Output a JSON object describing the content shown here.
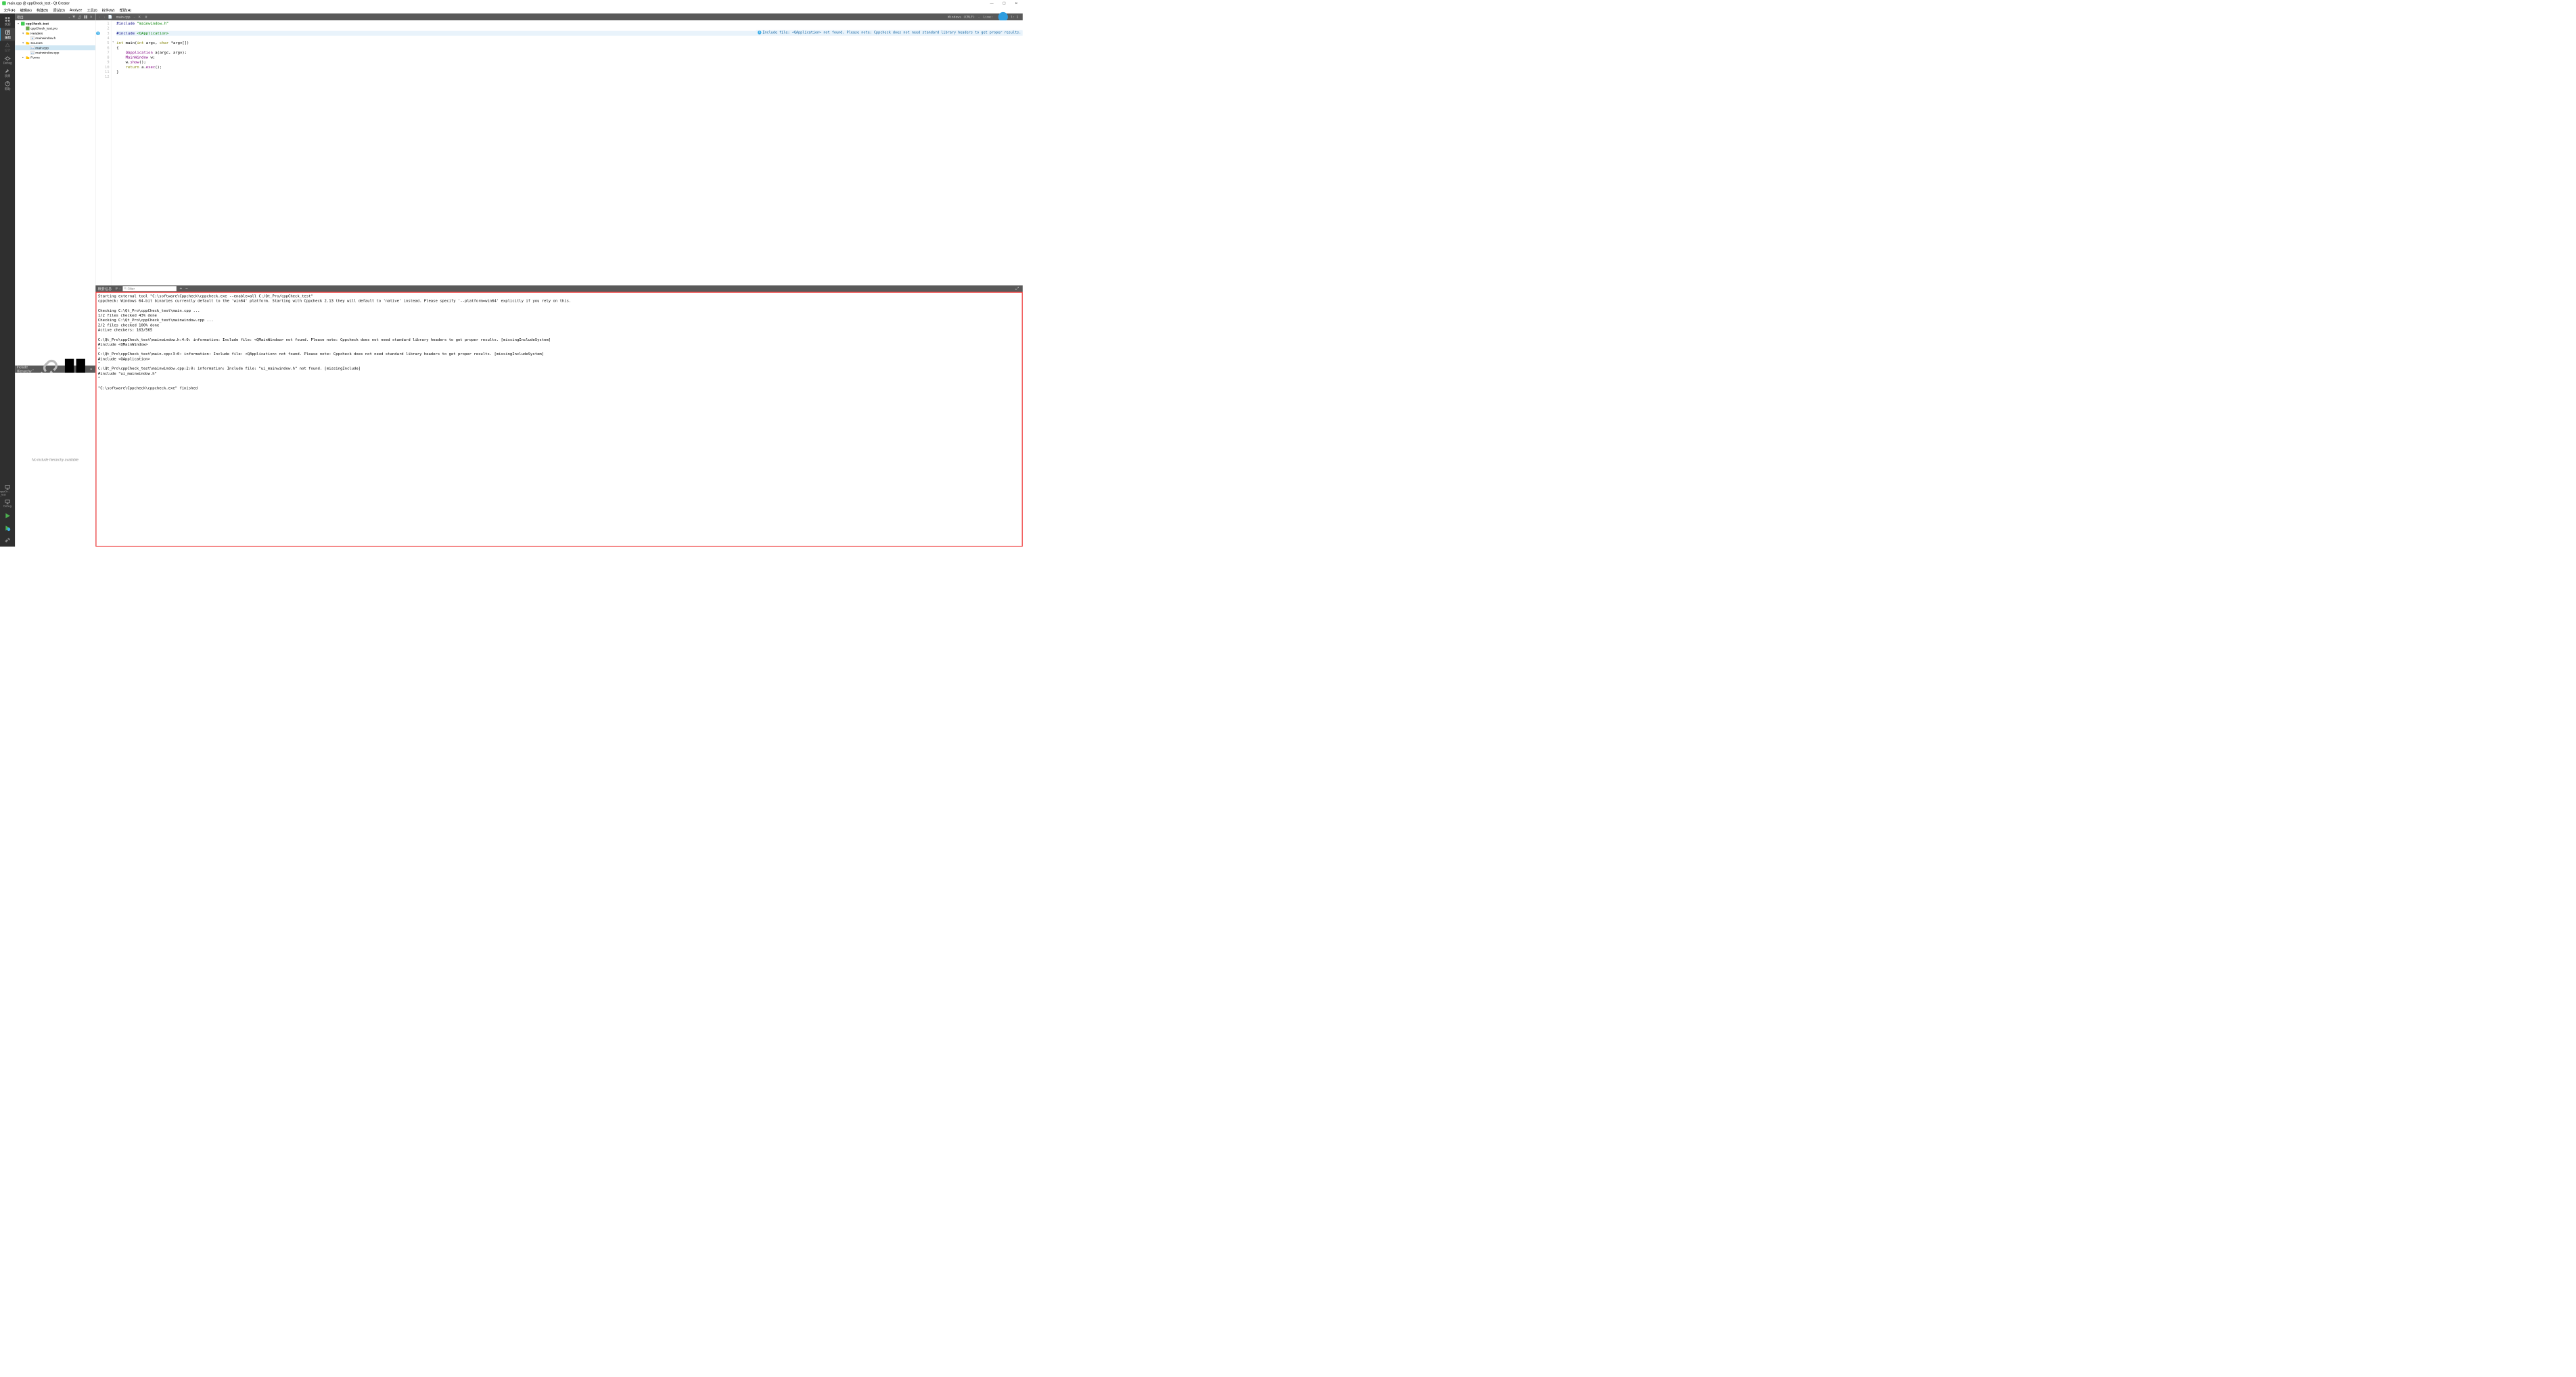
{
  "title": "main.cpp @ cppCheck_test - Qt Creator",
  "menu": [
    "文件(F)",
    "编辑(E)",
    "构建(B)",
    "调试(D)",
    "Analyze",
    "工具(I)",
    "控件(W)",
    "帮助(H)"
  ],
  "winbtns": {
    "min": "—",
    "max": "☐",
    "close": "✕"
  },
  "leftbar": [
    {
      "label": "欢迎",
      "icon": "grid"
    },
    {
      "label": "编辑",
      "icon": "edit",
      "sel": true
    },
    {
      "label": "设计",
      "icon": "design",
      "dis": true
    },
    {
      "label": "Debug",
      "icon": "bug"
    },
    {
      "label": "项目",
      "icon": "wrench"
    },
    {
      "label": "帮助",
      "icon": "help"
    }
  ],
  "kit": "cppCh…_test",
  "kit2": "Debug",
  "project_panel": {
    "title": "项目",
    "tree": [
      {
        "d": 0,
        "arrow": "▾",
        "ico": "proj",
        "label": "cppCheck_test",
        "bold": true
      },
      {
        "d": 1,
        "arrow": "",
        "ico": "pro",
        "label": "cppCheck_test.pro"
      },
      {
        "d": 1,
        "arrow": "▾",
        "ico": "folder",
        "label": "Headers"
      },
      {
        "d": 2,
        "arrow": "",
        "ico": "h",
        "label": "mainwindow.h"
      },
      {
        "d": 1,
        "arrow": "▾",
        "ico": "folder",
        "label": "Sources"
      },
      {
        "d": 2,
        "arrow": "",
        "ico": "cpp",
        "label": "main.cpp",
        "sel": true
      },
      {
        "d": 2,
        "arrow": "",
        "ico": "cpp",
        "label": "mainwindow.cpp"
      },
      {
        "d": 1,
        "arrow": "▸",
        "ico": "folder",
        "label": "Forms"
      }
    ]
  },
  "include_panel": {
    "title": "Include Hierarchy",
    "empty": "No include hierarchy available"
  },
  "editor_head": {
    "file": "main.cpp",
    "encoding": "Windows (CRLF)",
    "linecol": "Line: ",
    "col": "l: 1",
    "symbol": "#"
  },
  "banner": "Include file: <QApplication> not found. Please note: Cppcheck does not need standard library headers to get proper results.",
  "code": [
    {
      "n": 1,
      "html": "<span class='pre'>#include</span> <span class='inc'>\"mainwindow.h\"</span>"
    },
    {
      "n": 2,
      "html": ""
    },
    {
      "n": 3,
      "html": "<span class='pre'>#include</span> <span class='inc'>&lt;QApplication&gt;</span>",
      "mark": "info",
      "cur": true
    },
    {
      "n": 4,
      "html": ""
    },
    {
      "n": 5,
      "html": "<span class='kw'>int</span> main(<span class='kw'>int</span> argc, <span class='kw'>char</span> *argv[])",
      "fold": "▾"
    },
    {
      "n": 6,
      "html": "{"
    },
    {
      "n": 7,
      "html": "    <span class='typ'>QApplication</span> a(argc, argv);"
    },
    {
      "n": 8,
      "html": "    <span class='typ'>MainWindow</span> w;"
    },
    {
      "n": 9,
      "html": "    w.<span class='typ'>show</span>();"
    },
    {
      "n": 10,
      "html": "    <span class='kw'>return</span> a.<span class='typ'>exec</span>();"
    },
    {
      "n": 11,
      "html": "}"
    },
    {
      "n": 12,
      "html": ""
    }
  ],
  "output": {
    "title": "概要信息",
    "filter_ph": "Filter",
    "lines": "Starting external tool \"C:\\software\\Cppcheck\\cppcheck.exe --enable=all C:/Qt_Pro/cppCheck_test\"\ncppcheck: Windows 64-bit binaries currently default to the 'win64' platform. Starting with Cppcheck 2.13 they will default to 'native' instead. Please specify '--platform=win64' explicitly if you rely on this.\n\nChecking C:\\Qt_Pro\\cppCheck_test\\main.cpp ...\n1/2 files checked 43% done\nChecking C:\\Qt_Pro\\cppCheck_test\\mainwindow.cpp ...\n2/2 files checked 100% done\nActive checkers: 163/565\n\nC:\\Qt_Pro\\cppCheck_test\\mainwindow.h:4:0: information: Include file: <QMainWindow> not found. Please note: Cppcheck does not need standard library headers to get proper results. [missingIncludeSystem]\n#include <QMainWindow>\n^\nC:\\Qt_Pro\\cppCheck_test\\main.cpp:3:0: information: Include file: <QApplication> not found. Please note: Cppcheck does not need standard library headers to get proper results. [missingIncludeSystem]\n#include <QApplication>\n^\nC:\\Qt_Pro\\cppCheck_test\\mainwindow.cpp:2:0: information: Include file: \"ui_mainwindow.h\" not found. [missingInclude]\n#include \"ui_mainwindow.h\"\n^\n\n\"C:\\software\\Cppcheck\\cppcheck.exe\" finished"
  }
}
